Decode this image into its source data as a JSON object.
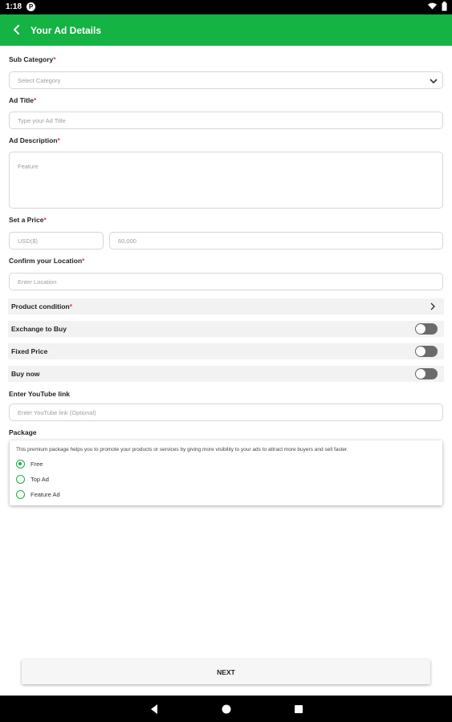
{
  "status_bar": {
    "time": "1:18",
    "app_badge": "P"
  },
  "app_bar": {
    "title": "Your Ad Details"
  },
  "form": {
    "sub_category": {
      "label": "Sub Category",
      "required_mark": "*",
      "placeholder": "Select Category"
    },
    "ad_title": {
      "label": "Ad Title",
      "required_mark": "*",
      "placeholder": "Type your Ad Title"
    },
    "ad_description": {
      "label": "Ad Description",
      "required_mark": "*",
      "placeholder": "Feature"
    },
    "price": {
      "label": "Set a Price",
      "required_mark": "*",
      "currency_value": "USD($)",
      "amount_placeholder": "60,000"
    },
    "location": {
      "label": "Confirm your Location",
      "required_mark": "*",
      "placeholder": "Enter Location"
    },
    "product_condition": {
      "label": "Product condition",
      "required_mark": "*"
    },
    "exchange_to_buy": {
      "label": "Exchange to Buy",
      "enabled": false
    },
    "fixed_price": {
      "label": "Fixed Price",
      "enabled": false
    },
    "buy_now": {
      "label": "Buy now",
      "enabled": false
    },
    "youtube": {
      "label": "Enter YouTube link",
      "placeholder": "Enter YouTube link (Optional)"
    }
  },
  "package": {
    "label": "Package",
    "description": "This premium package helps you to promote your products or services by giving more visibility to your ads to attract more buyers and sell faster.",
    "options": [
      {
        "label": "Free",
        "selected": true
      },
      {
        "label": "Top Ad",
        "selected": false
      },
      {
        "label": "Feature Ad",
        "selected": false
      }
    ]
  },
  "next_label": "NEXT",
  "colors": {
    "accent": "#14B343",
    "required": "#e53935",
    "toggle_off": "#6b6b6b"
  }
}
